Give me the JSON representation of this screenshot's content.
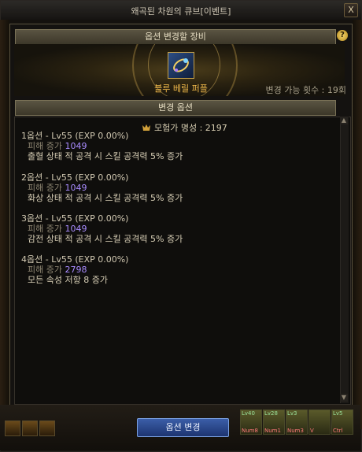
{
  "window": {
    "title": "왜곡된 차원의 큐브[이벤트]",
    "close_label": "X"
  },
  "equip_section": {
    "header": "옵션 변경할 장비",
    "help_label": "?",
    "item_name": "블루 베릴 퍼플",
    "change_count": "변경 가능 횟수 : 19회"
  },
  "options_section": {
    "header": "변경 옵션",
    "fame": "모험가 명성 : 2197",
    "options": [
      {
        "header": "1옵션 - Lv55 (EXP 0.00%)",
        "stat_label": "피해 증가",
        "stat_value": "1049",
        "effect": "출혈 상태 적 공격 시 스킬 공격력 5% 증가"
      },
      {
        "header": "2옵션 - Lv55 (EXP 0.00%)",
        "stat_label": "피해 증가",
        "stat_value": "1049",
        "effect": "화상 상태 적 공격 시 스킬 공격력 5% 증가"
      },
      {
        "header": "3옵션 - Lv55 (EXP 0.00%)",
        "stat_label": "피해 증가",
        "stat_value": "1049",
        "effect": "감전 상태 적 공격 시 스킬 공격력 5% 증가"
      },
      {
        "header": "4옵션 - Lv55 (EXP 0.00%)",
        "stat_label": "피해 증가",
        "stat_value": "2798",
        "effect": "모든 속성 저항 8 증가"
      }
    ]
  },
  "footer": {
    "confirm_label": "옵션 변경",
    "skill_slots": [
      {
        "lv": "Lv40",
        "name": "Num8"
      },
      {
        "lv": "Lv28",
        "name": "Num1"
      },
      {
        "lv": "Lv3",
        "name": "Num3"
      },
      {
        "lv": "",
        "name": "V"
      },
      {
        "lv": "Lv5",
        "name": "Ctrl"
      }
    ]
  }
}
